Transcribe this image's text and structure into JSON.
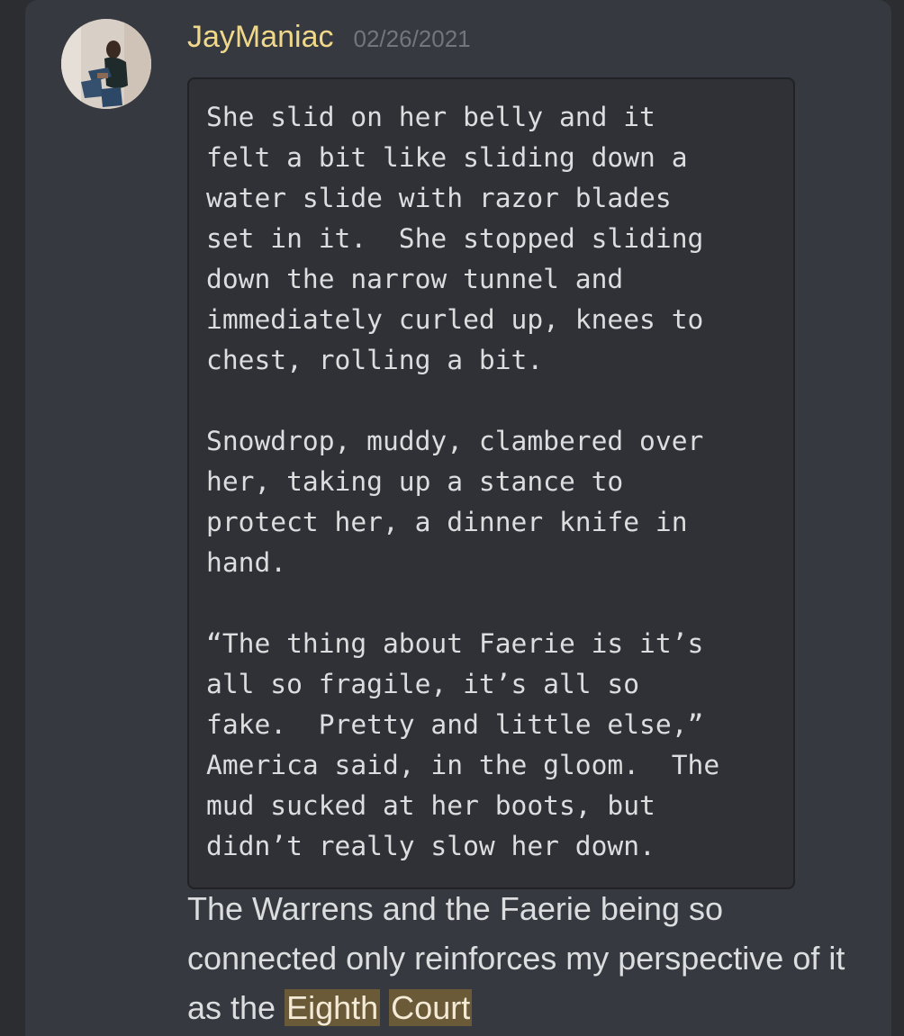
{
  "message": {
    "username": "JayManiac",
    "timestamp": "02/26/2021",
    "avatar": "user-avatar-photo",
    "code_block": "She slid on her belly and it\nfelt a bit like sliding down a\nwater slide with razor blades\nset in it.  She stopped sliding\ndown the narrow tunnel and\nimmediately curled up, knees to\nchest, rolling a bit.\n\nSnowdrop, muddy, clambered over\nher, taking up a stance to\nprotect her, a dinner knife in\nhand.\n\n“The thing about Faerie is it’s\nall so fragile, it’s all so\nfake.  Pretty and little else,”\nAmerica said, in the gloom.  The\nmud sucked at her boots, but\ndidn’t really slow her down.",
    "text_before": "The Warrens and the Faerie being so connected only reinforces my perspective of it as the ",
    "highlight_word_1": "Eighth",
    "highlight_word_2": "Court"
  },
  "colors": {
    "background": "#2b2d31",
    "card": "#36393f",
    "username": "#f0d88a",
    "timestamp": "#72767d",
    "code_bg": "#2f3136",
    "text": "#dcddde",
    "highlight": "#6b5a37"
  }
}
